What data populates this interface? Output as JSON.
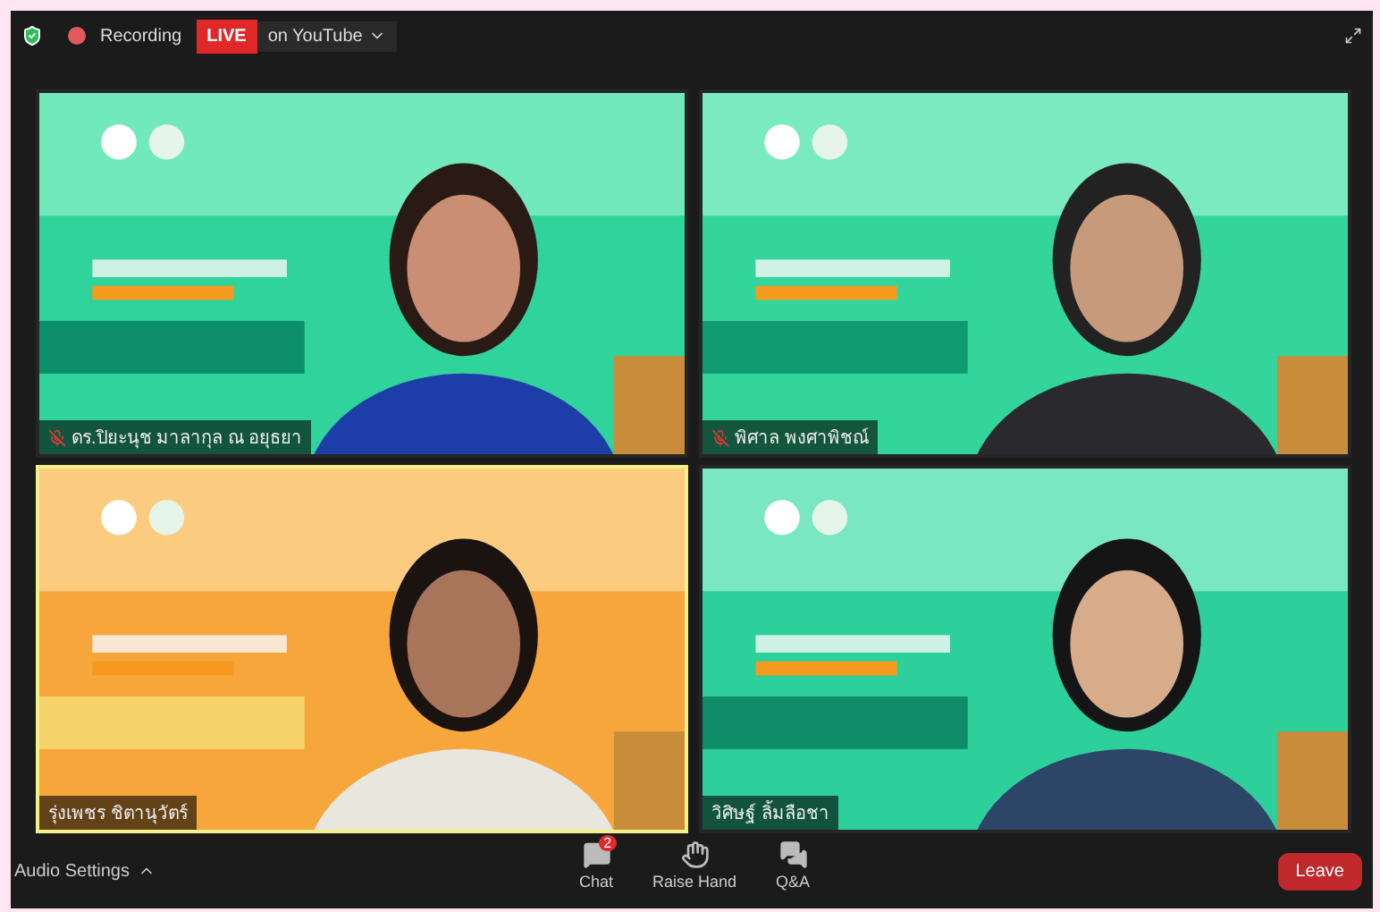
{
  "top_bar": {
    "recording": {
      "label": "Recording"
    },
    "live": {
      "badge": "LIVE",
      "destination": "on YouTube"
    }
  },
  "tiles": [
    {
      "name": "ดร.ปิยะนุช มาลากุล ณ อยุธยา",
      "muted": true,
      "active_speaker": false
    },
    {
      "name": "พิศาล พงศาพิชณ์",
      "muted": true,
      "active_speaker": false
    },
    {
      "name": "รุ่งเพชร ชิตานุวัตร์",
      "muted": false,
      "active_speaker": true
    },
    {
      "name": "วิศิษฐ์ ลิ้มลือชา",
      "muted": false,
      "active_speaker": false
    }
  ],
  "toolbar": {
    "audio_settings": "Audio Settings",
    "buttons": [
      {
        "kind": "chat",
        "label": "Chat",
        "badge": "2"
      },
      {
        "kind": "hand",
        "label": "Raise Hand"
      },
      {
        "kind": "qa",
        "label": "Q&A"
      }
    ],
    "leave": "Leave"
  }
}
